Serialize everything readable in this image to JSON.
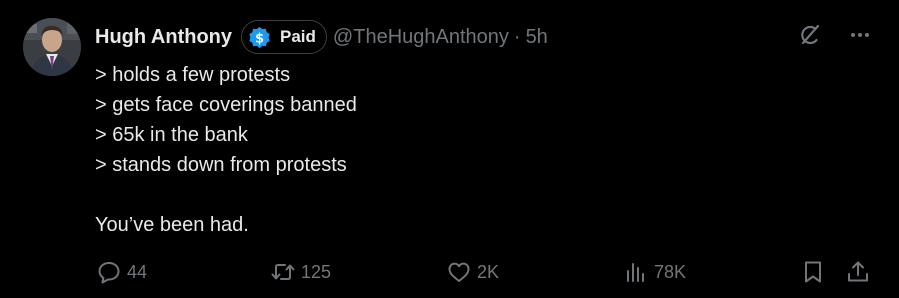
{
  "author": {
    "display_name": "Hugh Anthony",
    "badge_label": "Paid",
    "handle": "@TheHughAnthony",
    "separator": "·",
    "time": "5h"
  },
  "tweet": {
    "lines": [
      "> holds a few protests",
      "> gets face coverings banned",
      "> 65k in the bank",
      "> stands down from protests"
    ],
    "closing": "You’ve been had."
  },
  "actions": {
    "replies": "44",
    "reposts": "125",
    "likes": "2K",
    "views": "78K"
  },
  "colors": {
    "background": "#000000",
    "text": "#e7e9ea",
    "muted": "#71767b",
    "badge_blue": "#1d9bf0"
  },
  "icons": {
    "badge": "dollar-icon",
    "grok": "grok-icon",
    "more": "more-icon",
    "reply": "reply-icon",
    "repost": "repost-icon",
    "like": "heart-icon",
    "views": "views-icon",
    "bookmark": "bookmark-icon",
    "share": "share-icon"
  }
}
